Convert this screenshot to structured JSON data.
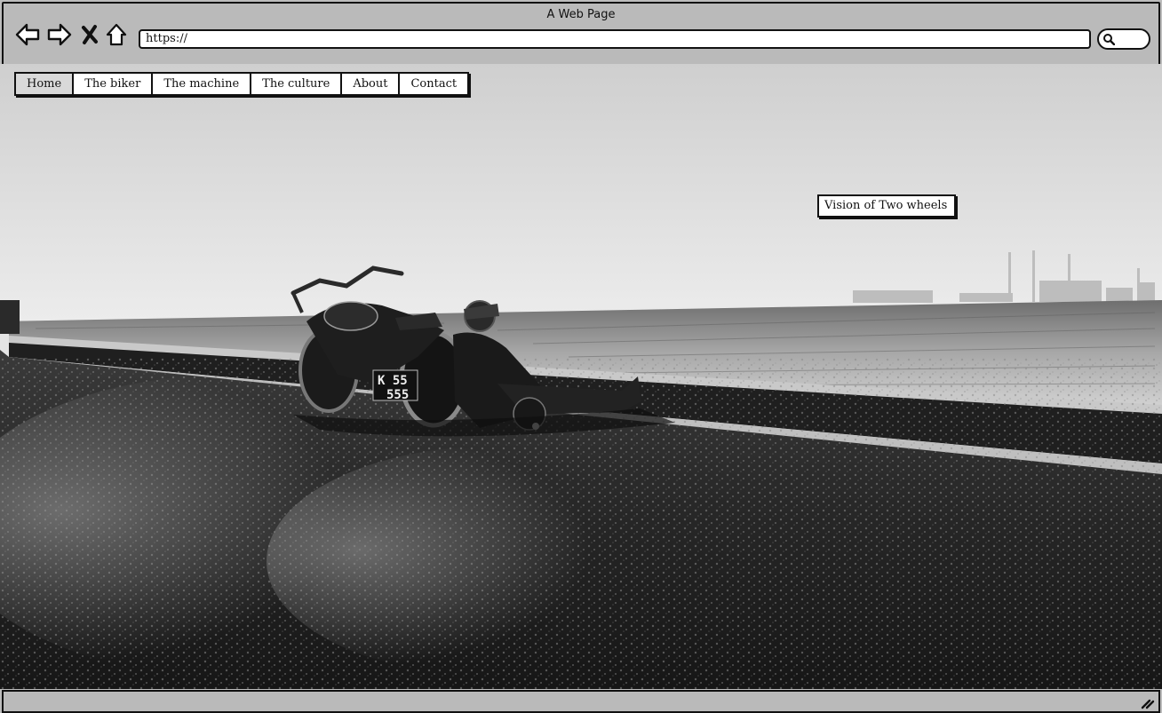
{
  "window": {
    "title": "A Web Page"
  },
  "toolbar": {
    "url": "https://",
    "icons": [
      "back-arrow-icon",
      "forward-arrow-icon",
      "close-x-icon",
      "home-icon",
      "search-icon"
    ]
  },
  "nav": {
    "items": [
      {
        "label": "Home",
        "active": true
      },
      {
        "label": "The biker",
        "active": false
      },
      {
        "label": "The machine",
        "active": false
      },
      {
        "label": "The culture",
        "active": false
      },
      {
        "label": "About",
        "active": false
      },
      {
        "label": "Contact",
        "active": false
      }
    ]
  },
  "hero": {
    "caption": "Vision of Two wheels",
    "plate_line1": "K 55",
    "plate_line2": "555"
  },
  "colors": {
    "chrome": "#bababa",
    "stroke": "#111111",
    "active_tab": "#d9d9d9"
  }
}
